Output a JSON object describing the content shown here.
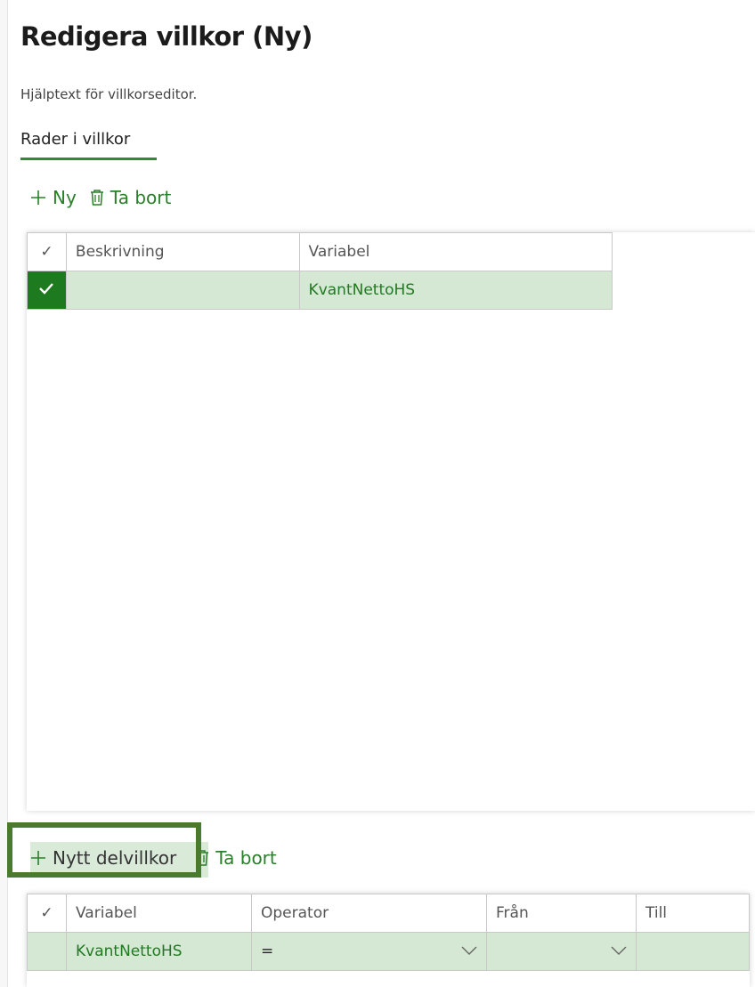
{
  "page": {
    "title": "Redigera villkor (Ny)",
    "help_text": "Hjälptext för villkorseditor.",
    "tab_label": "Rader i villkor"
  },
  "toolbar1": {
    "new_label": "Ny",
    "delete_label": "Ta bort"
  },
  "grid1": {
    "headers": {
      "check": "✓",
      "description": "Beskrivning",
      "variable": "Variabel"
    },
    "rows": [
      {
        "checked": true,
        "description": "",
        "variable": "KvantNettoHS"
      }
    ]
  },
  "toolbar2": {
    "new_label": "Nytt delvillkor",
    "delete_label": "Ta bort"
  },
  "grid2": {
    "headers": {
      "check": "✓",
      "variable": "Variabel",
      "operator": "Operator",
      "from": "Från",
      "to": "Till"
    },
    "rows": [
      {
        "variable": "KvantNettoHS",
        "operator": "=",
        "from": "",
        "to": ""
      }
    ]
  },
  "colors": {
    "accent": "#2e8b2e",
    "row_selected": "#d4e8d4",
    "check_selected": "#1e7a1e",
    "highlight_box": "#4a7a2e"
  }
}
